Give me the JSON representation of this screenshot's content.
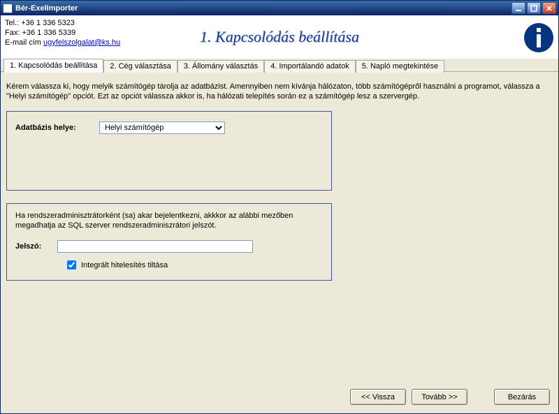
{
  "window": {
    "title": "Bér-ExelImporter"
  },
  "header": {
    "tel_line": "Tel.: +36 1 336 5323",
    "fax_line": "Fax: +36 1 336 5339",
    "email_prefix": "E-mail cím ",
    "email_link": "ugyfelszolgalat@ks.hu",
    "step_title": "1. Kapcsolódás beállítása"
  },
  "tabs": [
    "1. Kapcsolódás beállítása",
    "2. Cég választása",
    "3. Állomány választás",
    "4. Importálandó adatok",
    "5. Napló megtekintése"
  ],
  "instructions": "Kérem válassza ki, hogy melyik számítógép tárolja az adatbázist. Amennyiben nem kívánja hálózaton, több számítógépről használni a programot, válassza a \"Helyi számítógép\" opciót. Ezt az opciót válassza akkor is, ha hálózati telepítés során ez a számítógép lesz a szervergép.",
  "db": {
    "label": "Adatbázis helye:",
    "value": "Helyi számítógép"
  },
  "pw": {
    "info": "Ha rendszeradminisztrátorként (sa) akar bejelentkezni, akkkor az alábbi mezőben megadhatja az SQL szerver rendszeradminiszrátori jelszót.",
    "label": "Jelszó:",
    "value": "",
    "checkbox_label": "Integrált hitelesítés tiltása",
    "checkbox_checked": true
  },
  "buttons": {
    "back": "<< Vissza",
    "next": "Tovább >>",
    "close": "Bezárás"
  }
}
